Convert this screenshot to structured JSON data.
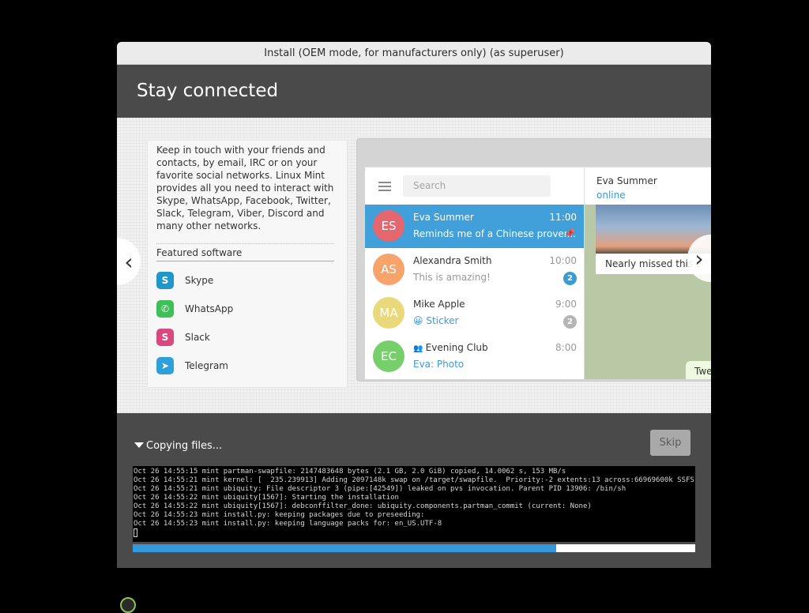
{
  "window": {
    "title": "Install (OEM mode, for manufacturers only) (as superuser)"
  },
  "header": {
    "title": "Stay connected"
  },
  "slide": {
    "description": "Keep in touch with your friends and contacts, by email, IRC or on your favorite social networks. Linux Mint provides all you need to interact with Skype, WhatsApp, Facebook, Twitter, Slack, Telegram, Viber, Discord and many other networks.",
    "featured_title": "Featured software",
    "apps": [
      {
        "label": "Skype",
        "icon": "skype-icon",
        "color": "#2196c9",
        "glyph": "S"
      },
      {
        "label": "WhatsApp",
        "icon": "whatsapp-icon",
        "color": "#3fbf58",
        "glyph": "✆"
      },
      {
        "label": "Slack",
        "icon": "slack-icon",
        "color": "#d84a7f",
        "glyph": "S"
      },
      {
        "label": "Telegram",
        "icon": "telegram-icon",
        "color": "#2e9fd8",
        "glyph": "➤"
      }
    ],
    "prev_glyph": "‹",
    "next_glyph": "›"
  },
  "telegram": {
    "search_placeholder": "Search",
    "chats": [
      {
        "initials": "ES",
        "name": "Eva Summer",
        "time": "11:00",
        "message": "Reminds me of a Chinese prover...",
        "color": "#e4676f",
        "active": true,
        "pinned": true
      },
      {
        "initials": "AS",
        "name": "Alexandra Smith",
        "time": "10:00",
        "message": "This is amazing!",
        "color": "#f7a46c",
        "badge": "2",
        "badge_color": "#3a9bd5"
      },
      {
        "initials": "MA",
        "name": "Mike Apple",
        "time": "9:00",
        "message": "😀 Sticker",
        "color": "#ead97a",
        "badge": "2",
        "badge_color": "#b5b5b5",
        "message_blue": true
      },
      {
        "initials": "EC",
        "name": "Evening Club",
        "time": "8:00",
        "message": "Eva: Photo",
        "color": "#76cf6b",
        "message_blue": true,
        "group": true
      }
    ],
    "conversation": {
      "name": "Eva Summer",
      "status": "online",
      "bubble": "Nearly missed this s",
      "bubble2": "Twe"
    }
  },
  "progress": {
    "section_label": "Copying files...",
    "skip_label": "Skip",
    "fraction": 0.753,
    "log": [
      "Oct 26 14:55:15 mint partman-swapfile: 2147483648 bytes (2.1 GB, 2.0 GiB) copied, 14.0062 s, 153 MB/s",
      "Oct 26 14:55:21 mint kernel: [  235.239913] Adding 2097148k swap on /target/swapfile.  Priority:-2 extents:13 across:66969600k SSFS",
      "Oct 26 14:55:21 mint ubiquity: File descriptor 3 (pipe:[42549]) leaked on pvs invocation. Parent PID 13906: /bin/sh",
      "Oct 26 14:55:22 mint ubiquity[1567]: Starting the installation",
      "Oct 26 14:55:22 mint ubiquity[1567]: debconffilter_done: ubiquity.components.partman_commit (current: None)",
      "Oct 26 14:55:23 mint install.py: keeping packages due to preseeding:",
      "Oct 26 14:55:23 mint install.py: keeping language packs for: en_US.UTF-8"
    ]
  }
}
